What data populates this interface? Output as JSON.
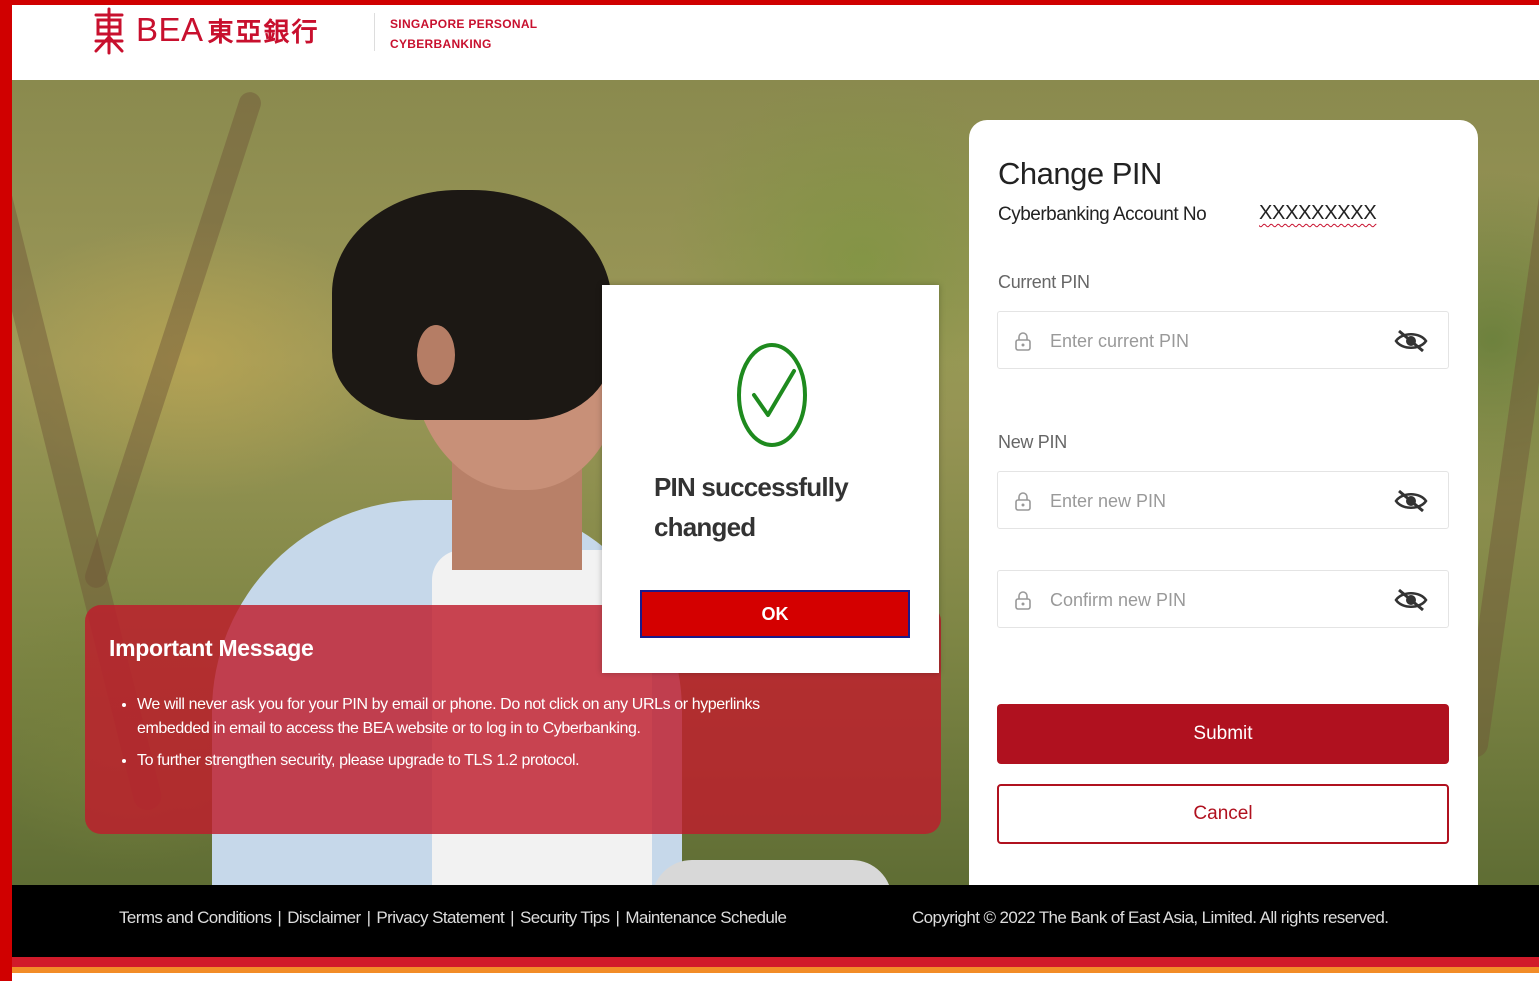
{
  "header": {
    "logo_text": "BEA",
    "logo_cn": "東亞銀行",
    "subtitle_line1": "SINGAPORE PERSONAL",
    "subtitle_line2": "CYBERBANKING"
  },
  "important": {
    "title": "Important Message",
    "items": [
      "We will never ask you for your PIN by email or phone. Do not click on any URLs or hyperlinks embedded in email to access the BEA website or to log in to Cyberbanking.",
      "To further strengthen security, please upgrade to TLS 1.2 protocol."
    ]
  },
  "modal": {
    "message": "PIN successfully changed",
    "ok_label": "OK"
  },
  "form": {
    "title": "Change PIN",
    "account_label": "Cyberbanking Account No",
    "account_value": "XXXXXXXXX",
    "current_label": "Current PIN",
    "current_placeholder": "Enter current PIN",
    "new_label": "New PIN",
    "new_placeholder": "Enter new PIN",
    "confirm_placeholder": "Confirm new PIN",
    "submit_label": "Submit",
    "cancel_label": "Cancel"
  },
  "footer": {
    "links": [
      "Terms and Conditions",
      "Disclaimer",
      "Privacy Statement",
      "Security Tips",
      "Maintenance Schedule"
    ],
    "separator": "|",
    "copyright": "Copyright © 2022 The Bank of East Asia, Limited. All rights reserved."
  },
  "colors": {
    "brand_red": "#c8102e",
    "button_red": "#b0111f",
    "ok_red": "#d40000",
    "success_green": "#1e8a1e"
  },
  "icons": {
    "logo": "bea-logo-icon",
    "success": "check-circle-icon",
    "lock": "lock-icon",
    "eye": "eye-slash-icon"
  }
}
